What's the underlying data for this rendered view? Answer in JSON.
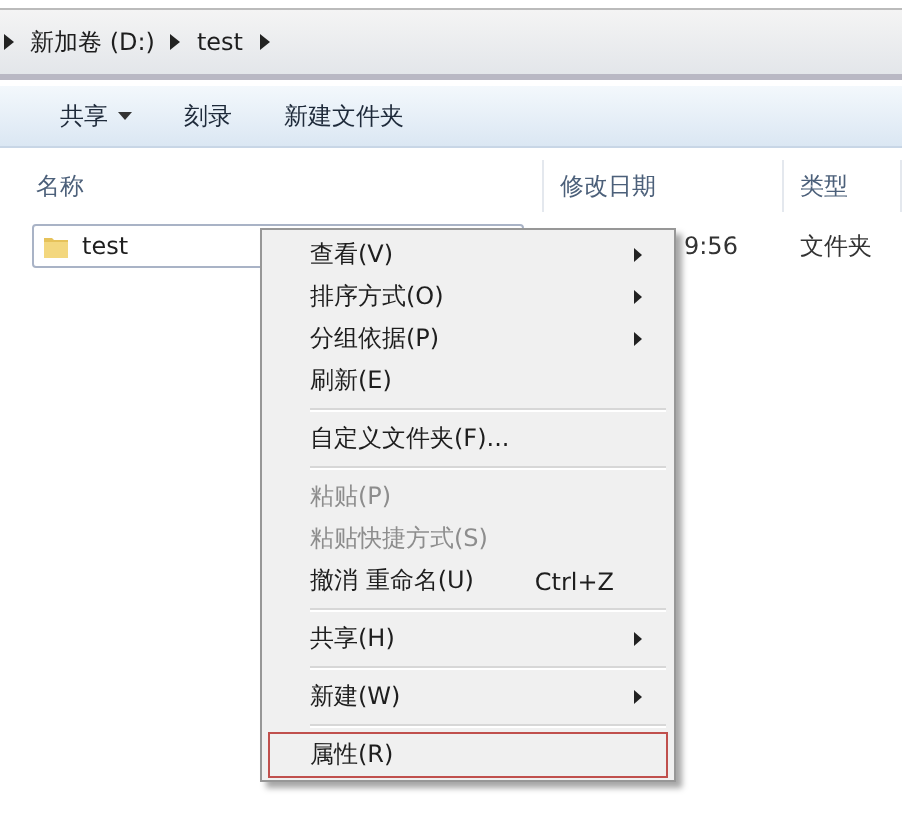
{
  "address_bar": {
    "segments": [
      "新加卷 (D:)",
      "test"
    ]
  },
  "toolbar": {
    "buttons": [
      {
        "label": "共享",
        "dropdown": true
      },
      {
        "label": "刻录",
        "dropdown": false
      },
      {
        "label": "新建文件夹",
        "dropdown": false
      }
    ]
  },
  "table": {
    "columns": [
      "名称",
      "修改日期",
      "类型"
    ],
    "rows": [
      {
        "name": "test",
        "date": "9:56",
        "type": "文件夹",
        "selected": true
      }
    ]
  },
  "context_menu": {
    "items": [
      {
        "kind": "item",
        "label": "查看(V)",
        "submenu": true,
        "disabled": false
      },
      {
        "kind": "item",
        "label": "排序方式(O)",
        "submenu": true,
        "disabled": false
      },
      {
        "kind": "item",
        "label": "分组依据(P)",
        "submenu": true,
        "disabled": false
      },
      {
        "kind": "item",
        "label": "刷新(E)",
        "submenu": false,
        "disabled": false
      },
      {
        "kind": "separator"
      },
      {
        "kind": "item",
        "label": "自定义文件夹(F)...",
        "submenu": false,
        "disabled": false
      },
      {
        "kind": "separator"
      },
      {
        "kind": "item",
        "label": "粘贴(P)",
        "submenu": false,
        "disabled": true
      },
      {
        "kind": "item",
        "label": "粘贴快捷方式(S)",
        "submenu": false,
        "disabled": true
      },
      {
        "kind": "item",
        "label": "撤消 重命名(U)",
        "shortcut": "Ctrl+Z",
        "submenu": false,
        "disabled": false
      },
      {
        "kind": "separator"
      },
      {
        "kind": "item",
        "label": "共享(H)",
        "submenu": true,
        "disabled": false
      },
      {
        "kind": "separator"
      },
      {
        "kind": "item",
        "label": "新建(W)",
        "submenu": true,
        "disabled": false
      },
      {
        "kind": "separator"
      },
      {
        "kind": "item",
        "label": "属性(R)",
        "submenu": false,
        "disabled": false,
        "highlighted": true
      }
    ]
  }
}
